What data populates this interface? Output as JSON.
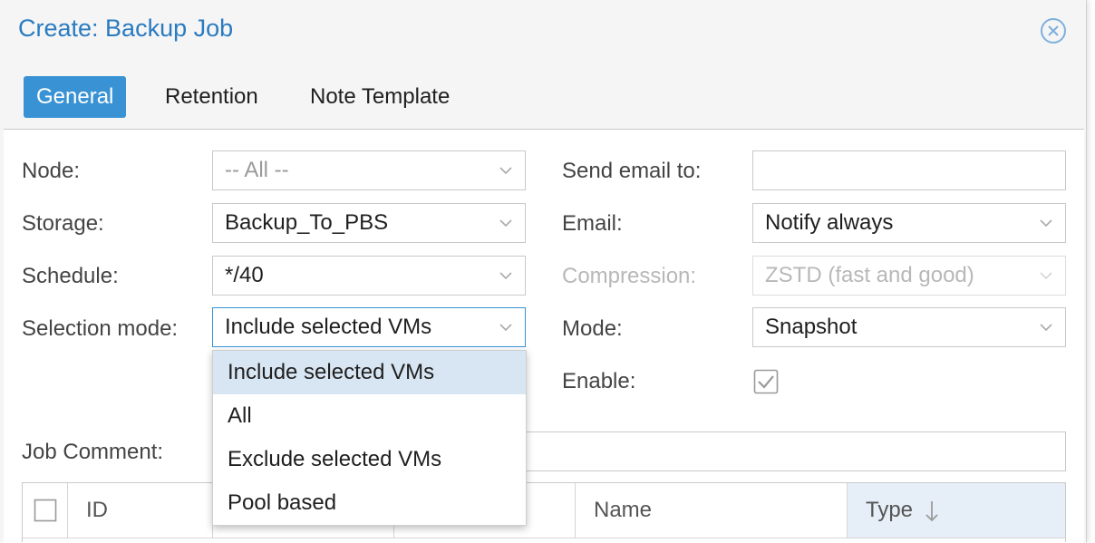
{
  "dialog": {
    "title": "Create: Backup Job"
  },
  "tabs": [
    {
      "label": "General",
      "active": true
    },
    {
      "label": "Retention",
      "active": false
    },
    {
      "label": "Note Template",
      "active": false
    }
  ],
  "form": {
    "node": {
      "label": "Node:",
      "value": "-- All --"
    },
    "storage": {
      "label": "Storage:",
      "value": "Backup_To_PBS"
    },
    "schedule": {
      "label": "Schedule:",
      "value": "*/40"
    },
    "selection_mode": {
      "label": "Selection mode:",
      "value": "Include selected VMs"
    },
    "send_email_to": {
      "label": "Send email to:",
      "value": ""
    },
    "email": {
      "label": "Email:",
      "value": "Notify always"
    },
    "compression": {
      "label": "Compression:",
      "value": "ZSTD (fast and good)",
      "disabled": true
    },
    "mode": {
      "label": "Mode:",
      "value": "Snapshot"
    },
    "enable": {
      "label": "Enable:",
      "checked": true
    },
    "job_comment": {
      "label": "Job Comment:",
      "value": ""
    }
  },
  "selection_dropdown": {
    "options": [
      "Include selected VMs",
      "All",
      "Exclude selected VMs",
      "Pool based"
    ],
    "selected_index": 0
  },
  "grid": {
    "columns": [
      {
        "label": ""
      },
      {
        "label": "ID"
      },
      {
        "label": ""
      },
      {
        "label": ""
      },
      {
        "label": "Name"
      },
      {
        "label": "Type",
        "sorted": "desc"
      }
    ]
  },
  "colors": {
    "accent": "#3892d4",
    "title": "#2a7bc0",
    "selected_item": "#d8e6f3"
  }
}
